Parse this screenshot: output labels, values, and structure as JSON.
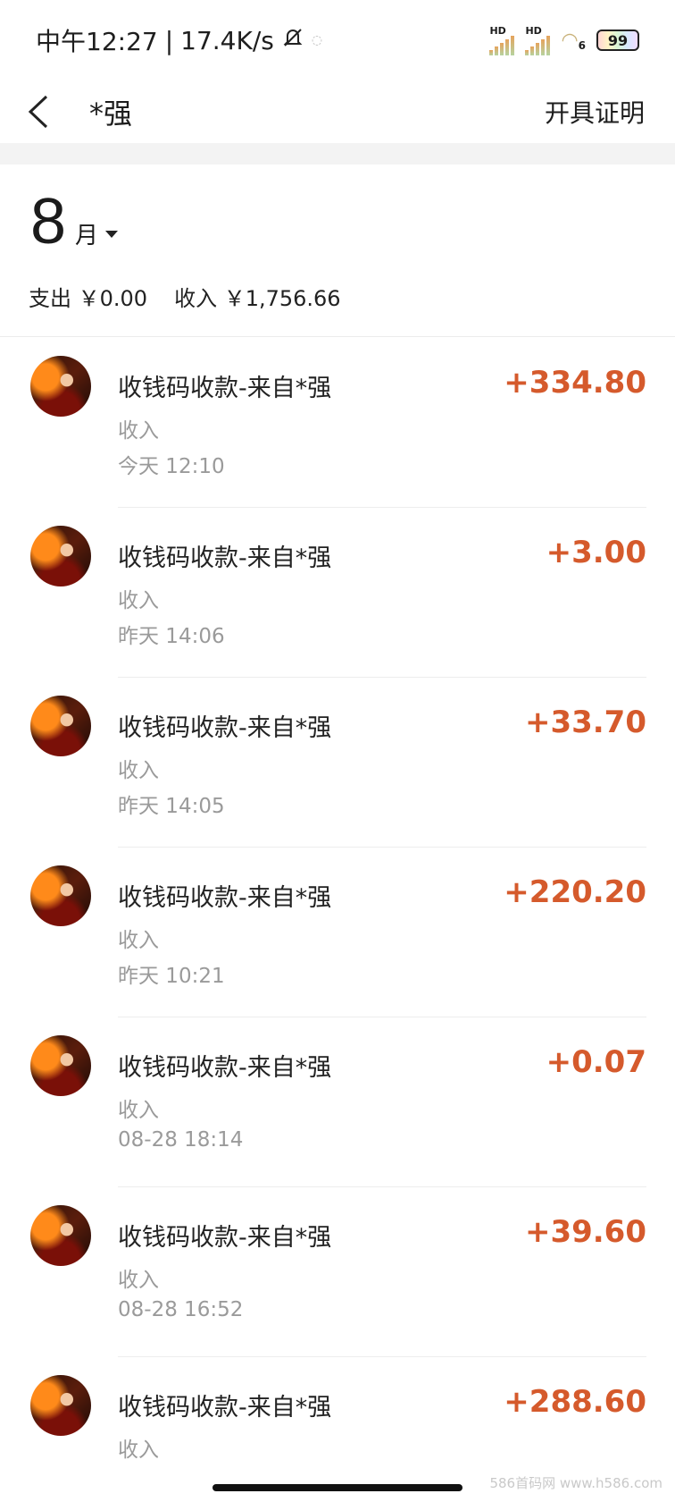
{
  "status_bar": {
    "time": "中午12:27",
    "separator": "|",
    "speed": "17.4K/s",
    "hd1": "HD",
    "hd2": "HD",
    "wifi_label": "6",
    "battery": "99"
  },
  "header": {
    "title": "*强",
    "action": "开具证明"
  },
  "month": {
    "number": "8",
    "unit": "月"
  },
  "summary": {
    "expense": "支出 ￥0.00",
    "income": "收入 ￥1,756.66"
  },
  "transactions": [
    {
      "title": "收钱码收款-来自*强",
      "type": "收入",
      "time": "今天  12:10",
      "amount": "+334.80"
    },
    {
      "title": "收钱码收款-来自*强",
      "type": "收入",
      "time": "昨天  14:06",
      "amount": "+3.00"
    },
    {
      "title": "收钱码收款-来自*强",
      "type": "收入",
      "time": "昨天  14:05",
      "amount": "+33.70"
    },
    {
      "title": "收钱码收款-来自*强",
      "type": "收入",
      "time": "昨天  10:21",
      "amount": "+220.20"
    },
    {
      "title": "收钱码收款-来自*强",
      "type": "收入",
      "time": "08-28  18:14",
      "amount": "+0.07"
    },
    {
      "title": "收钱码收款-来自*强",
      "type": "收入",
      "time": "08-28  16:52",
      "amount": "+39.60"
    },
    {
      "title": "收钱码收款-来自*强",
      "type": "收入",
      "time": "",
      "amount": "+288.60"
    }
  ],
  "watermark": "586首码网 www.h586.com",
  "colors": {
    "amount": "#d55a2c",
    "secondary_text": "#9a9a9a"
  }
}
